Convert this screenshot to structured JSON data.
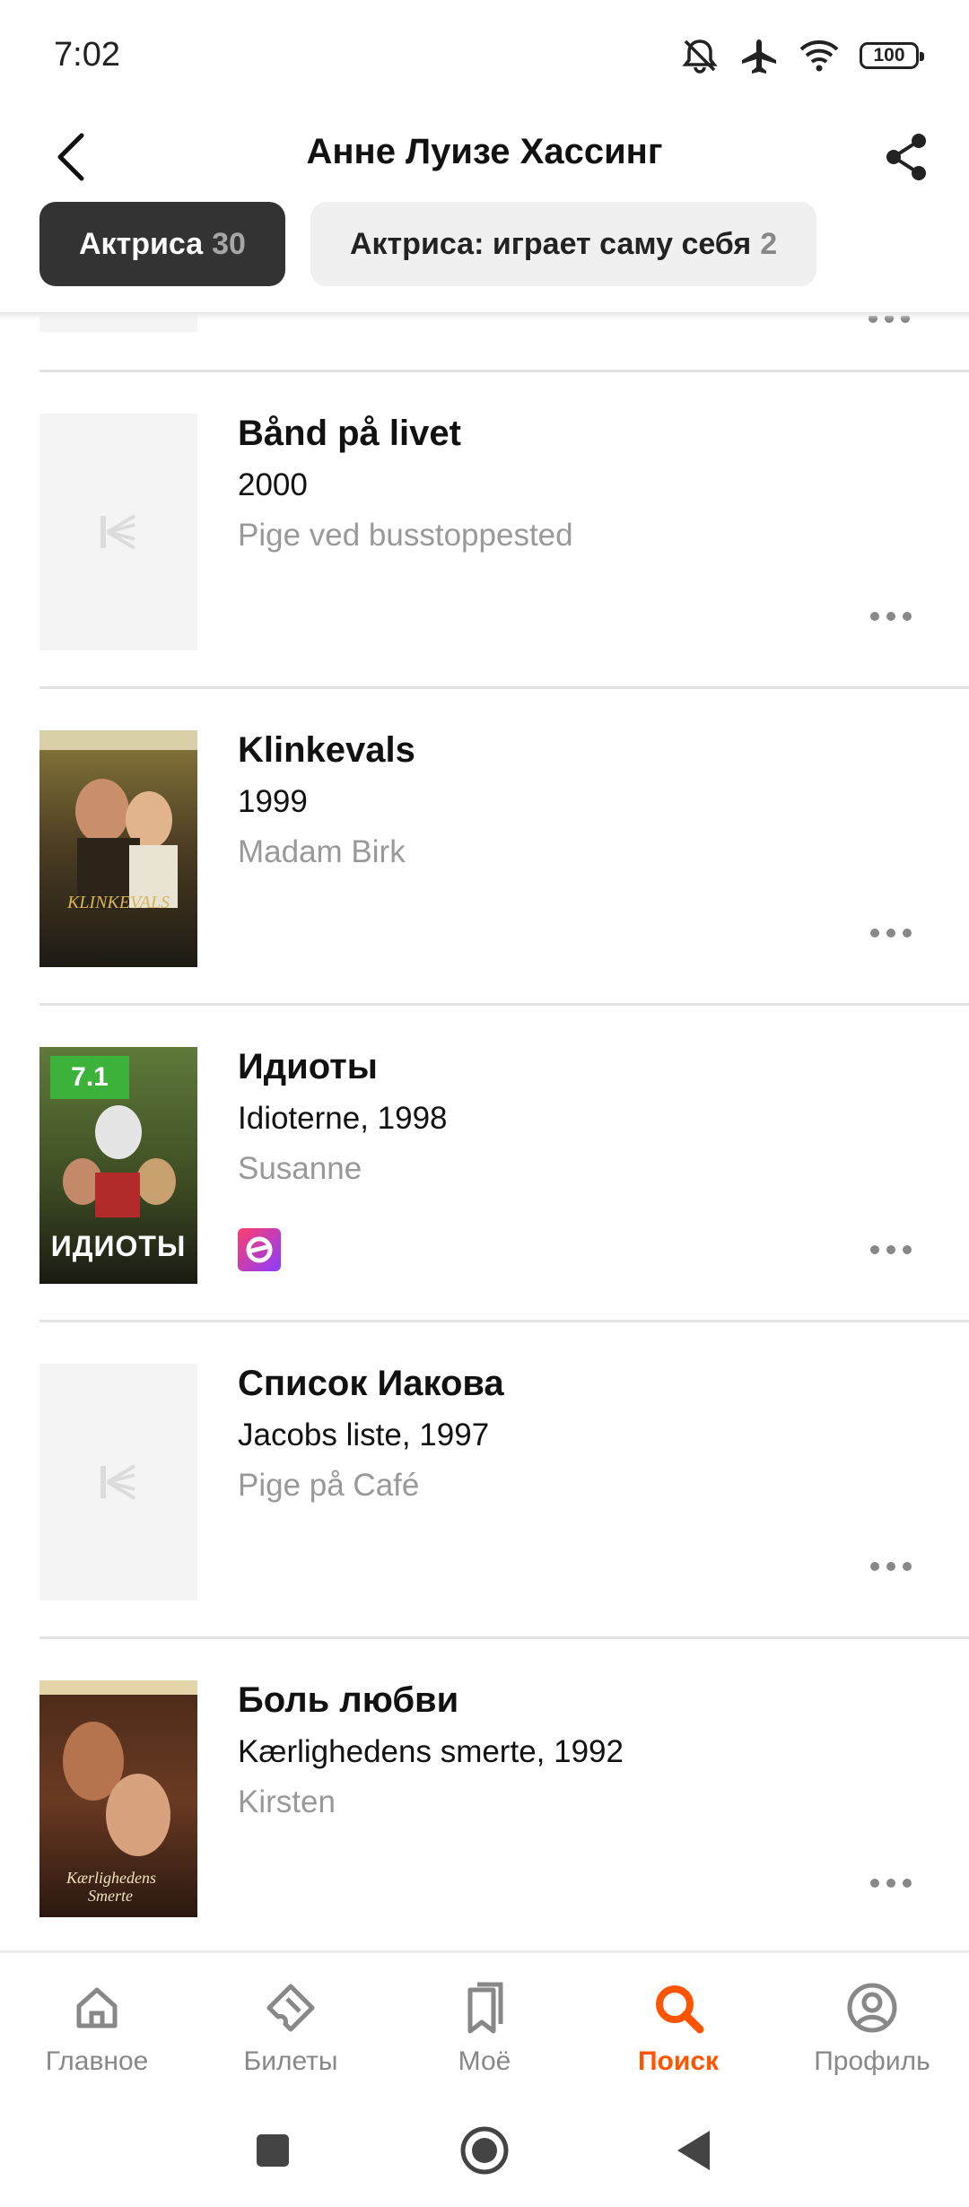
{
  "status_bar": {
    "time": "7:02",
    "battery": "100",
    "icons": [
      "mute-icon",
      "airplane-icon",
      "wifi-icon",
      "battery-icon"
    ]
  },
  "header": {
    "title": "Анне Луизе Хассинг"
  },
  "tabs": [
    {
      "label": "Актриса",
      "count": "30",
      "active": true
    },
    {
      "label": "Актриса: играет саму себя",
      "count": "2",
      "active": false
    }
  ],
  "films": [
    {
      "title": "Bånd på livet",
      "subtitle": "2000",
      "role": "Pige ved busstoppested",
      "poster": "placeholder"
    },
    {
      "title": "Klinkevals",
      "subtitle": "1999",
      "role": "Madam Birk",
      "poster": "image"
    },
    {
      "title": "Идиоты",
      "subtitle": "Idioterne, 1998",
      "role": "Susanne",
      "poster": "image",
      "rating": "7.1",
      "poster_text": "ИДИОТЫ",
      "streaming": true
    },
    {
      "title": "Список Иакова",
      "subtitle": "Jacobs liste, 1997",
      "role": "Pige på Café",
      "poster": "placeholder"
    },
    {
      "title": "Боль любви",
      "subtitle": "Kærlighedens smerte, 1992",
      "role": "Kirsten",
      "poster": "image"
    }
  ],
  "bottom_nav": [
    {
      "label": "Главное",
      "icon": "home-icon",
      "active": false
    },
    {
      "label": "Билеты",
      "icon": "ticket-icon",
      "active": false
    },
    {
      "label": "Моё",
      "icon": "bookmark-icon",
      "active": false
    },
    {
      "label": "Поиск",
      "icon": "search-icon",
      "active": true
    },
    {
      "label": "Профиль",
      "icon": "profile-icon",
      "active": false
    }
  ],
  "colors": {
    "accent": "#ff5500",
    "tab_active_bg": "#333333",
    "tab_inactive_bg": "#f0f0f0",
    "rating_green": "#3bb33b",
    "secondary_text": "#999999"
  }
}
